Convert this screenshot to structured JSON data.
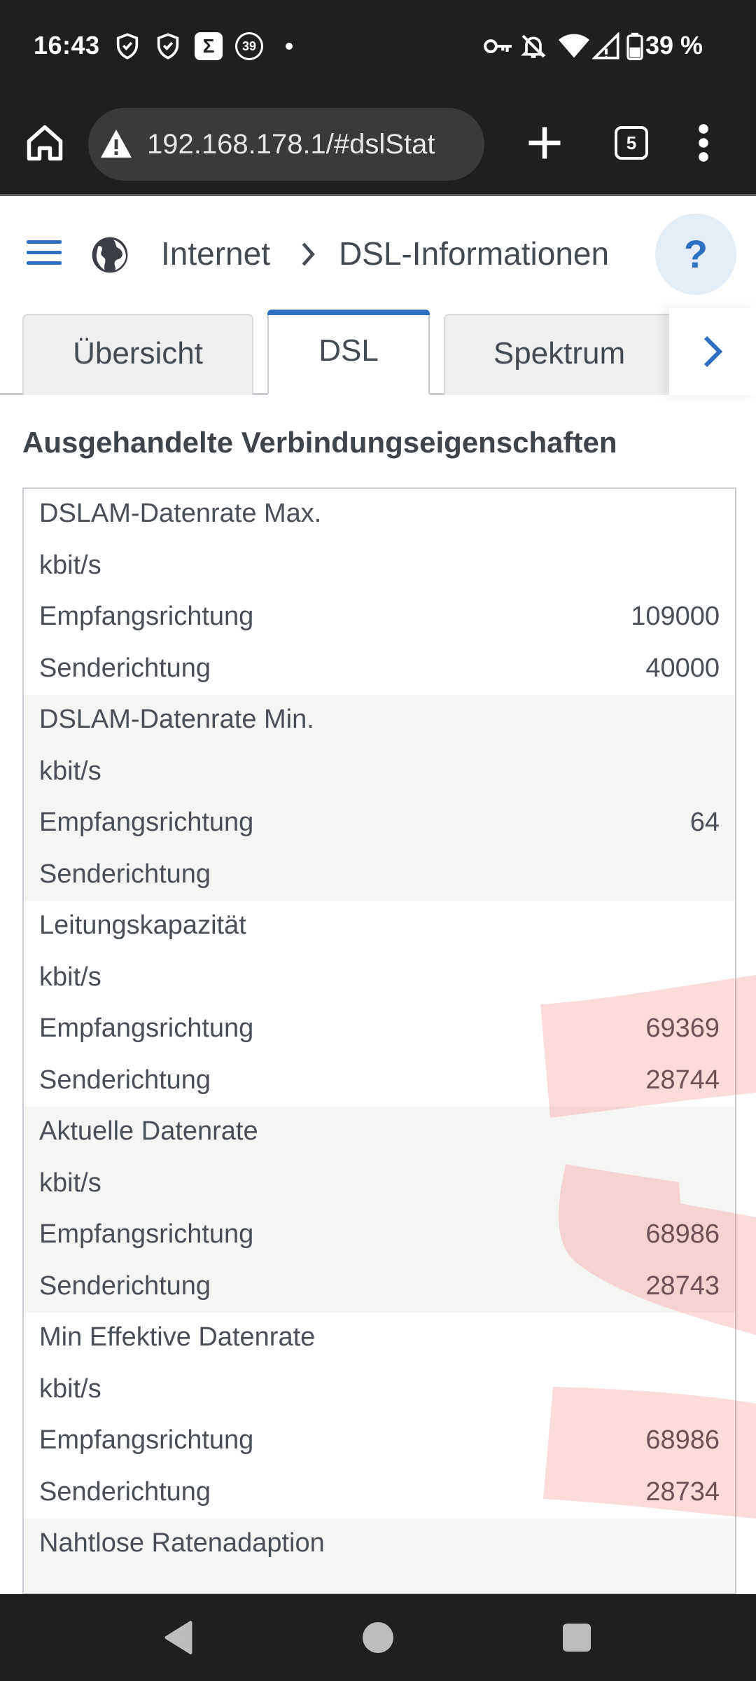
{
  "statusbar": {
    "time": "16:43",
    "badge_sigma": "Σ",
    "badge_count": "39",
    "battery": "39 %",
    "icons": [
      "shield-icon",
      "shield-check-icon",
      "sigma-app-icon",
      "notification-count-icon",
      "dot-icon",
      "vpn-key-icon",
      "bell-off-icon",
      "wifi-icon",
      "signal-icon",
      "battery-icon"
    ]
  },
  "browser": {
    "url": "192.168.178.1/#dslStat",
    "tab_count": "5",
    "icons": [
      "home-icon",
      "warning-icon",
      "plus-icon",
      "tabs-icon",
      "more-vert-icon"
    ]
  },
  "header": {
    "breadcrumb_root": "Internet",
    "breadcrumb_current": "DSL-Informationen",
    "help_label": "?",
    "accent_color": "#2e6fc2"
  },
  "tabs": [
    {
      "label": "Übersicht",
      "active": false
    },
    {
      "label": "DSL",
      "active": true
    },
    {
      "label": "Spektrum",
      "active": false
    }
  ],
  "section": {
    "title": "Ausgehandelte Verbindungseigenschaften"
  },
  "groups": [
    {
      "title": "DSLAM-Datenrate Max.",
      "unit": "kbit/s",
      "rows": [
        {
          "label": "Empfangsrichtung",
          "value": "109000"
        },
        {
          "label": "Senderichtung",
          "value": "40000"
        }
      ]
    },
    {
      "title": "DSLAM-Datenrate Min.",
      "unit": "kbit/s",
      "rows": [
        {
          "label": "Empfangsrichtung",
          "value": "64"
        },
        {
          "label": "Senderichtung",
          "value": ""
        }
      ]
    },
    {
      "title": "Leitungskapazität",
      "unit": "kbit/s",
      "rows": [
        {
          "label": "Empfangsrichtung",
          "value": "69369"
        },
        {
          "label": "Senderichtung",
          "value": "28744"
        }
      ]
    },
    {
      "title": "Aktuelle Datenrate",
      "unit": "kbit/s",
      "rows": [
        {
          "label": "Empfangsrichtung",
          "value": "68986"
        },
        {
          "label": "Senderichtung",
          "value": "28743"
        }
      ]
    },
    {
      "title": "Min Effektive Datenrate",
      "unit": "kbit/s",
      "rows": [
        {
          "label": "Empfangsrichtung",
          "value": "68986"
        },
        {
          "label": "Senderichtung",
          "value": "28734"
        }
      ]
    },
    {
      "title": "Nahtlose Ratenadaption",
      "unit": "",
      "rows": []
    }
  ],
  "navbar": {
    "icons": [
      "back-icon",
      "home-circle-icon",
      "recents-icon"
    ]
  }
}
